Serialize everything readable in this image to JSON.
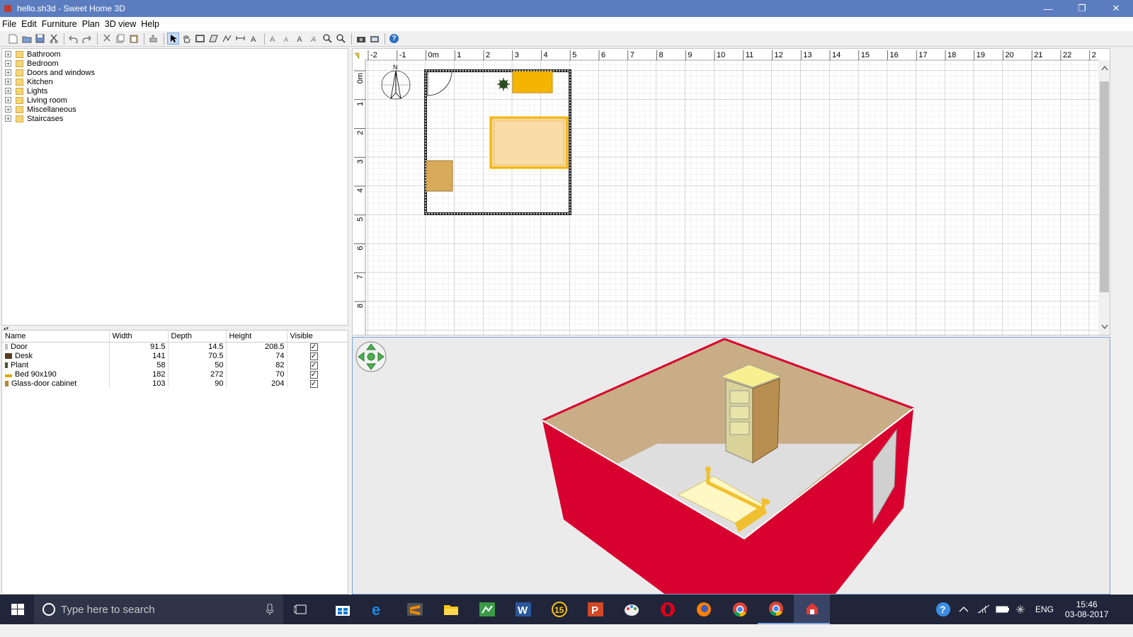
{
  "window": {
    "title": "hello.sh3d - Sweet Home 3D",
    "minimize_glyph": "—",
    "maximize_glyph": "❐",
    "close_glyph": "✕"
  },
  "menu": [
    "File",
    "Edit",
    "Furniture",
    "Plan",
    "3D view",
    "Help"
  ],
  "toolbar": {
    "icons": [
      "new-home-icon",
      "open-icon",
      "save-icon",
      "cut-icon",
      "undo-icon",
      "redo-icon",
      "cut-icon",
      "copy-icon",
      "paste-icon",
      "add-furniture-icon",
      "select-mode-icon",
      "pan-mode-icon",
      "create-walls-icon",
      "create-rooms-icon",
      "create-polylines-icon",
      "create-dimensions-icon",
      "create-labels-icon",
      "increase-text-size-icon",
      "decrease-text-size-icon",
      "bold-icon",
      "italic-icon",
      "zoom-in-icon",
      "zoom-out-icon",
      "create-photo-icon",
      "create-video-icon",
      "help-icon"
    ],
    "help_glyph": "?"
  },
  "catalog": {
    "categories": [
      "Bathroom",
      "Bedroom",
      "Doors and windows",
      "Kitchen",
      "Lights",
      "Living room",
      "Miscellaneous",
      "Staircases"
    ],
    "expander_glyph": "+"
  },
  "furniture_table": {
    "columns": [
      "Name",
      "Width",
      "Depth",
      "Height",
      "Visible"
    ],
    "rows": [
      {
        "name": "Door",
        "width": "91.5",
        "depth": "14.5",
        "height": "208.5",
        "visible": "✓",
        "icon_color": "#c0c0c0"
      },
      {
        "name": "Desk",
        "width": "141",
        "depth": "70.5",
        "height": "74",
        "visible": "✓",
        "icon_color": "#5a3d1e"
      },
      {
        "name": "Plant",
        "width": "58",
        "depth": "50",
        "height": "82",
        "visible": "✓",
        "icon_color": "#3d5a2a"
      },
      {
        "name": "Bed 90x190",
        "width": "182",
        "depth": "272",
        "height": "70",
        "visible": "✓",
        "icon_color": "#e0a800"
      },
      {
        "name": "Glass-door cabinet",
        "width": "103",
        "depth": "90",
        "height": "204",
        "visible": "✓",
        "icon_color": "#b8862b"
      }
    ]
  },
  "plan": {
    "x_ruler": [
      "-2",
      "-1",
      "0m",
      "1",
      "2",
      "3",
      "4",
      "5",
      "6",
      "7",
      "8",
      "9",
      "10",
      "11",
      "12",
      "13",
      "14",
      "15",
      "16",
      "17",
      "18",
      "19",
      "20",
      "21",
      "22",
      "2"
    ],
    "y_ruler": [
      "0m",
      "1",
      "2",
      "3",
      "4",
      "5",
      "6",
      "7",
      "8"
    ],
    "compass_label": "N",
    "colors": {
      "bed": "#f7d79a",
      "bed_frame": "#f5b400",
      "desk": "#f5b400",
      "cabinet": "#d8ab5a",
      "plant": "#2f4d22"
    }
  },
  "view3d": {
    "colors": {
      "walls": "#d8002e",
      "floor": "#c8ad86",
      "bed": "#f5e7a0",
      "bed_frame": "#f0c030",
      "cabinet": "#b88e50"
    }
  },
  "taskbar": {
    "search_placeholder": "Type here to search",
    "apps": [
      "file-explorer-icon",
      "edge-icon",
      "sublime-icon",
      "explorer-folder-icon",
      "excel-icon",
      "word-icon",
      "app-15-icon",
      "powerpoint-icon",
      "paint-icon",
      "opera-icon",
      "firefox-icon",
      "chrome-icon",
      "chrome-canary-icon",
      "sweet-home-3d-icon"
    ],
    "language": "ENG",
    "time": "15:46",
    "date": "03-08-2017"
  }
}
